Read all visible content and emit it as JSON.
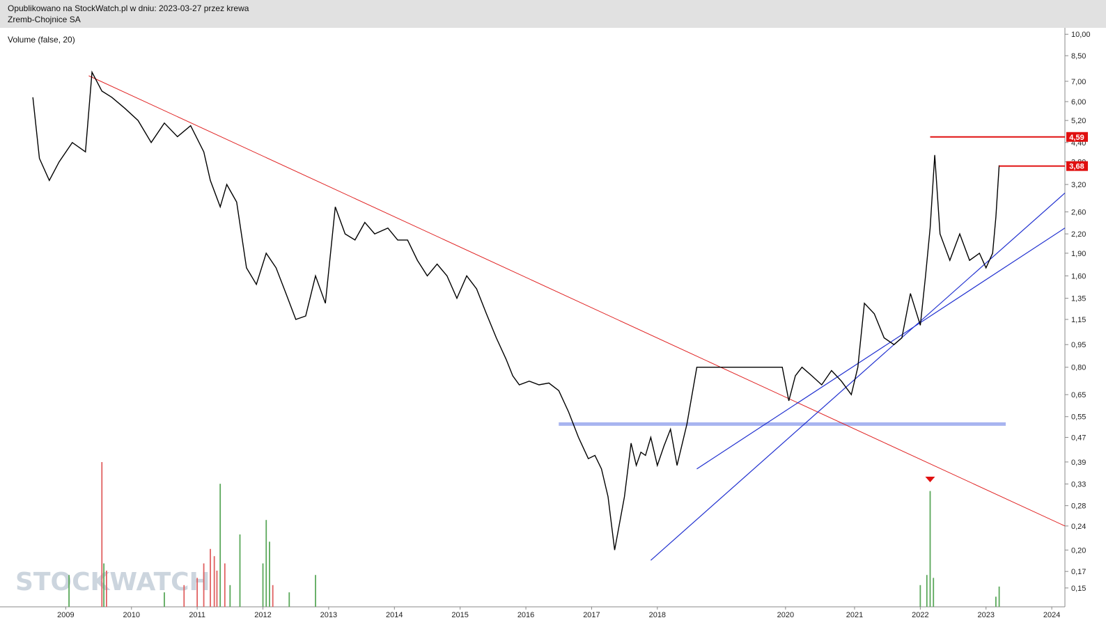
{
  "header": {
    "published": "Opublikowano na StockWatch.pl w dniu: 2023-03-27 przez krewa",
    "company": "Zremb-Chojnice SA"
  },
  "indicator_label": "Volume (false, 20)",
  "watermark": "STOCKWATCH",
  "colors": {
    "price": "#000000",
    "volume_up": "#5aa85a",
    "volume_down": "#e06060",
    "downtrend_line": "#e02020",
    "uptrend_lines": "#2030d0",
    "support_line": "#a8b4f0",
    "resistance_lines": "#e01010"
  },
  "chart_data": {
    "type": "line",
    "title": "",
    "scale": "log",
    "ylim": [
      0.13,
      10.5
    ],
    "xlim": [
      2008.0,
      2024.2
    ],
    "x_tick_labels": [
      "2009",
      "2010",
      "2011",
      "2012",
      "2013",
      "2014",
      "2015",
      "2016",
      "2017",
      "2018",
      "2020",
      "2021",
      "2022",
      "2023",
      "2024"
    ],
    "y_tick_labels": [
      "10,00",
      "8,50",
      "7,00",
      "6,00",
      "5,20",
      "4,40",
      "3,80",
      "3,20",
      "2,60",
      "2,20",
      "1,90",
      "1,60",
      "1,35",
      "1,15",
      "0,95",
      "0,80",
      "0,65",
      "0,55",
      "0,47",
      "0,39",
      "0,33",
      "0,28",
      "0,24",
      "0,20",
      "0,17",
      "0,15"
    ],
    "series": [
      {
        "type": "line",
        "x": [
          2008.5,
          2008.6,
          2008.75,
          2008.9,
          2009.1,
          2009.3,
          2009.4,
          2009.55,
          2009.7,
          2009.9,
          2010.1,
          2010.3,
          2010.5,
          2010.7,
          2010.9,
          2011.1,
          2011.2,
          2011.35,
          2011.45,
          2011.6,
          2011.75,
          2011.9,
          2012.05,
          2012.2,
          2012.35,
          2012.5,
          2012.65,
          2012.8,
          2012.95,
          2013.1,
          2013.25,
          2013.4,
          2013.55,
          2013.7,
          2013.9,
          2014.05,
          2014.2,
          2014.35,
          2014.5,
          2014.65,
          2014.8,
          2014.95,
          2015.1,
          2015.25,
          2015.4,
          2015.55,
          2015.7,
          2015.8,
          2015.9,
          2016.05,
          2016.2,
          2016.35,
          2016.5,
          2016.65,
          2016.8,
          2016.95,
          2017.05,
          2017.15,
          2017.25,
          2017.35,
          2017.5,
          2017.6,
          2017.68,
          2017.75,
          2017.82,
          2017.9,
          2018.0,
          2018.1,
          2018.2,
          2018.3,
          2018.45,
          2018.6,
          2019.9,
          2020.0,
          2020.1,
          2020.2,
          2020.35,
          2020.5,
          2020.65,
          2020.8,
          2020.95,
          2021.05,
          2021.15,
          2021.3,
          2021.45,
          2021.6,
          2021.72,
          2021.85,
          2022.0,
          2022.08,
          2022.15,
          2022.22,
          2022.3,
          2022.45,
          2022.6,
          2022.75,
          2022.9,
          2023.0,
          2023.1,
          2023.15,
          2023.2
        ],
        "y": [
          6.2,
          3.9,
          3.3,
          3.8,
          4.4,
          4.1,
          7.5,
          6.5,
          6.2,
          5.7,
          5.2,
          4.4,
          5.1,
          4.6,
          5.0,
          4.1,
          3.3,
          2.7,
          3.2,
          2.8,
          1.7,
          1.5,
          1.9,
          1.7,
          1.4,
          1.15,
          1.18,
          1.6,
          1.3,
          2.7,
          2.2,
          2.1,
          2.4,
          2.2,
          2.3,
          2.1,
          2.1,
          1.8,
          1.6,
          1.75,
          1.6,
          1.35,
          1.6,
          1.45,
          1.2,
          1.0,
          0.85,
          0.75,
          0.7,
          0.72,
          0.7,
          0.71,
          0.67,
          0.57,
          0.47,
          0.4,
          0.41,
          0.37,
          0.3,
          0.2,
          0.3,
          0.45,
          0.38,
          0.42,
          0.41,
          0.47,
          0.38,
          0.44,
          0.5,
          0.38,
          0.52,
          0.8,
          0.8,
          0.62,
          0.75,
          0.8,
          0.75,
          0.7,
          0.78,
          0.72,
          0.65,
          0.8,
          1.3,
          1.2,
          1.0,
          0.95,
          1.0,
          1.4,
          1.1,
          1.6,
          2.3,
          4.0,
          2.2,
          1.8,
          2.2,
          1.8,
          1.9,
          1.7,
          1.9,
          2.5,
          3.7
        ]
      },
      {
        "type": "bar",
        "name": "Volume",
        "x": [
          2009.05,
          2009.55,
          2009.58,
          2009.62,
          2010.5,
          2010.8,
          2011.0,
          2011.1,
          2011.2,
          2011.26,
          2011.3,
          2011.35,
          2011.42,
          2011.5,
          2011.65,
          2012.0,
          2012.05,
          2012.1,
          2012.15,
          2012.4,
          2012.8,
          2022.0,
          2022.1,
          2022.15,
          2022.2,
          2023.15,
          2023.2
        ],
        "values": [
          0.22,
          1.0,
          0.3,
          0.25,
          0.1,
          0.15,
          0.2,
          0.3,
          0.4,
          0.35,
          0.25,
          0.85,
          0.3,
          0.15,
          0.5,
          0.3,
          0.6,
          0.45,
          0.15,
          0.1,
          0.22,
          0.15,
          0.22,
          0.8,
          0.2,
          0.07,
          0.14
        ],
        "up": [
          true,
          false,
          true,
          false,
          true,
          false,
          false,
          false,
          false,
          false,
          false,
          true,
          false,
          true,
          true,
          true,
          true,
          true,
          false,
          true,
          true,
          true,
          true,
          true,
          true,
          true,
          true
        ]
      }
    ],
    "annotations": {
      "resistance_levels": [
        "4,59",
        "3,68"
      ],
      "resistance_values": [
        4.59,
        3.68
      ],
      "support_level": 0.52,
      "downtrend": [
        [
          2009.35,
          7.3
        ],
        [
          2024.2,
          0.24
        ]
      ],
      "uptrends": [
        [
          [
            2017.9,
            0.185
          ],
          [
            2024.2,
            3.0
          ]
        ],
        [
          [
            2018.6,
            0.37
          ],
          [
            2024.2,
            2.3
          ]
        ]
      ]
    }
  }
}
